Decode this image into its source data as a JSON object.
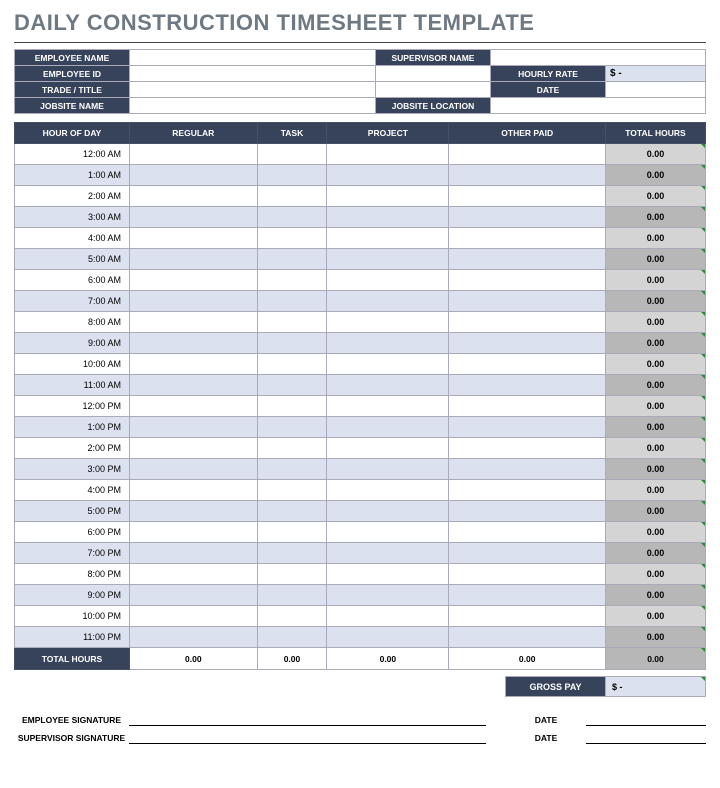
{
  "title": "DAILY CONSTRUCTION TIMESHEET TEMPLATE",
  "info": {
    "employee_name_label": "EMPLOYEE NAME",
    "employee_name": "",
    "supervisor_name_label": "SUPERVISOR NAME",
    "supervisor_name": "",
    "employee_id_label": "EMPLOYEE ID",
    "employee_id": "",
    "hourly_rate_label": "HOURLY RATE",
    "hourly_rate": "$                           -",
    "trade_title_label": "TRADE / TITLE",
    "trade_title": "",
    "date_label": "DATE",
    "date": "",
    "jobsite_name_label": "JOBSITE NAME",
    "jobsite_name": "",
    "jobsite_location_label": "JOBSITE LOCATION",
    "jobsite_location": ""
  },
  "columns": {
    "hour": "HOUR OF DAY",
    "regular": "REGULAR",
    "task": "TASK",
    "project": "PROJECT",
    "other": "OTHER PAID",
    "total": "TOTAL HOURS"
  },
  "hours": [
    {
      "label": "12:00 AM",
      "regular": "",
      "task": "",
      "project": "",
      "other": "",
      "total": "0.00"
    },
    {
      "label": "1:00 AM",
      "regular": "",
      "task": "",
      "project": "",
      "other": "",
      "total": "0.00"
    },
    {
      "label": "2:00 AM",
      "regular": "",
      "task": "",
      "project": "",
      "other": "",
      "total": "0.00"
    },
    {
      "label": "3:00 AM",
      "regular": "",
      "task": "",
      "project": "",
      "other": "",
      "total": "0.00"
    },
    {
      "label": "4:00 AM",
      "regular": "",
      "task": "",
      "project": "",
      "other": "",
      "total": "0.00"
    },
    {
      "label": "5:00 AM",
      "regular": "",
      "task": "",
      "project": "",
      "other": "",
      "total": "0.00"
    },
    {
      "label": "6:00 AM",
      "regular": "",
      "task": "",
      "project": "",
      "other": "",
      "total": "0.00"
    },
    {
      "label": "7:00 AM",
      "regular": "",
      "task": "",
      "project": "",
      "other": "",
      "total": "0.00"
    },
    {
      "label": "8:00 AM",
      "regular": "",
      "task": "",
      "project": "",
      "other": "",
      "total": "0.00"
    },
    {
      "label": "9:00 AM",
      "regular": "",
      "task": "",
      "project": "",
      "other": "",
      "total": "0.00"
    },
    {
      "label": "10:00 AM",
      "regular": "",
      "task": "",
      "project": "",
      "other": "",
      "total": "0.00"
    },
    {
      "label": "11:00 AM",
      "regular": "",
      "task": "",
      "project": "",
      "other": "",
      "total": "0.00"
    },
    {
      "label": "12:00 PM",
      "regular": "",
      "task": "",
      "project": "",
      "other": "",
      "total": "0.00"
    },
    {
      "label": "1:00 PM",
      "regular": "",
      "task": "",
      "project": "",
      "other": "",
      "total": "0.00"
    },
    {
      "label": "2:00 PM",
      "regular": "",
      "task": "",
      "project": "",
      "other": "",
      "total": "0.00"
    },
    {
      "label": "3:00 PM",
      "regular": "",
      "task": "",
      "project": "",
      "other": "",
      "total": "0.00"
    },
    {
      "label": "4:00 PM",
      "regular": "",
      "task": "",
      "project": "",
      "other": "",
      "total": "0.00"
    },
    {
      "label": "5:00 PM",
      "regular": "",
      "task": "",
      "project": "",
      "other": "",
      "total": "0.00"
    },
    {
      "label": "6:00 PM",
      "regular": "",
      "task": "",
      "project": "",
      "other": "",
      "total": "0.00"
    },
    {
      "label": "7:00 PM",
      "regular": "",
      "task": "",
      "project": "",
      "other": "",
      "total": "0.00"
    },
    {
      "label": "8:00 PM",
      "regular": "",
      "task": "",
      "project": "",
      "other": "",
      "total": "0.00"
    },
    {
      "label": "9:00 PM",
      "regular": "",
      "task": "",
      "project": "",
      "other": "",
      "total": "0.00"
    },
    {
      "label": "10:00 PM",
      "regular": "",
      "task": "",
      "project": "",
      "other": "",
      "total": "0.00"
    },
    {
      "label": "11:00 PM",
      "regular": "",
      "task": "",
      "project": "",
      "other": "",
      "total": "0.00"
    }
  ],
  "totals": {
    "label": "TOTAL HOURS",
    "regular": "0.00",
    "task": "0.00",
    "project": "0.00",
    "other": "0.00",
    "total": "0.00"
  },
  "gross": {
    "label": "GROSS PAY",
    "value": "$                           -"
  },
  "signatures": {
    "employee_label": "EMPLOYEE SIGNATURE",
    "supervisor_label": "SUPERVISOR SIGNATURE",
    "date_label": "DATE"
  }
}
